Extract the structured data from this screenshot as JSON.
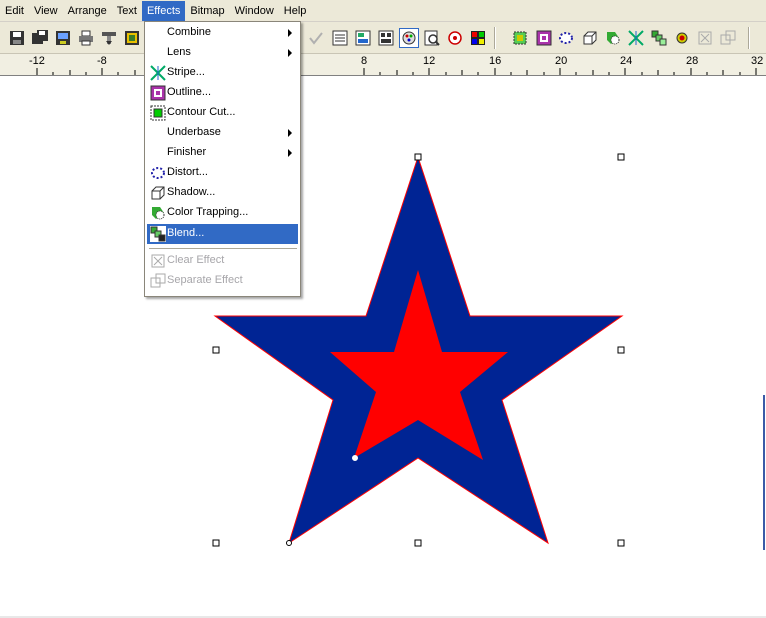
{
  "menubar": {
    "items": [
      "Edit",
      "View",
      "Arrange",
      "Text",
      "Effects",
      "Bitmap",
      "Window",
      "Help"
    ],
    "active": "Effects"
  },
  "toolbar": {
    "icons": [
      "save-icon",
      "save-all-icon",
      "export-icon",
      "print-icon",
      "cut-plotter-icon",
      "bitmap-export-icon",
      "check-icon",
      "properties-icon",
      "align-icon",
      "layers-icon",
      "palette-icon",
      "zoom-icon",
      "color-picker-icon",
      "color-grid-icon",
      "contour-icon",
      "outline-icon",
      "distort-icon",
      "shadow-icon",
      "trapping-icon",
      "stripe-icon",
      "blend-icon",
      "weld-icon",
      "clear-effect-icon",
      "separate-effect-icon"
    ]
  },
  "ruler": {
    "labels": [
      "-12",
      "-8",
      "8",
      "12",
      "16",
      "20",
      "24",
      "28",
      "32"
    ]
  },
  "effects_menu": {
    "items": [
      {
        "label": "Combine",
        "submenu": true,
        "icon": "",
        "enabled": true
      },
      {
        "label": "Lens",
        "submenu": true,
        "icon": "",
        "enabled": true
      },
      {
        "label": "Stripe...",
        "submenu": false,
        "icon": "stripe-icon",
        "enabled": true
      },
      {
        "label": "Outline...",
        "submenu": false,
        "icon": "outline-icon",
        "enabled": true
      },
      {
        "label": "Contour Cut...",
        "submenu": false,
        "icon": "contour-cut-icon",
        "enabled": true
      },
      {
        "label": "Underbase",
        "submenu": true,
        "icon": "",
        "enabled": true
      },
      {
        "label": "Finisher",
        "submenu": true,
        "icon": "",
        "enabled": true
      },
      {
        "label": "Distort...",
        "submenu": false,
        "icon": "distort-icon",
        "enabled": true
      },
      {
        "label": "Shadow...",
        "submenu": false,
        "icon": "shadow-icon",
        "enabled": true
      },
      {
        "label": "Color Trapping...",
        "submenu": false,
        "icon": "color-trapping-icon",
        "enabled": true
      },
      {
        "label": "Blend...",
        "submenu": false,
        "icon": "blend-icon",
        "enabled": true,
        "highlighted": true
      },
      {
        "label": "Clear Effect",
        "submenu": false,
        "icon": "clear-effect-icon",
        "enabled": false
      },
      {
        "label": "Separate Effect",
        "submenu": false,
        "icon": "separate-effect-icon",
        "enabled": false
      }
    ]
  },
  "colors": {
    "menu_highlight": "#316ac5",
    "star_outer": "#002494",
    "star_inner": "#ff0000",
    "outline": "#ff0000",
    "chrome": "#ece9d8"
  }
}
